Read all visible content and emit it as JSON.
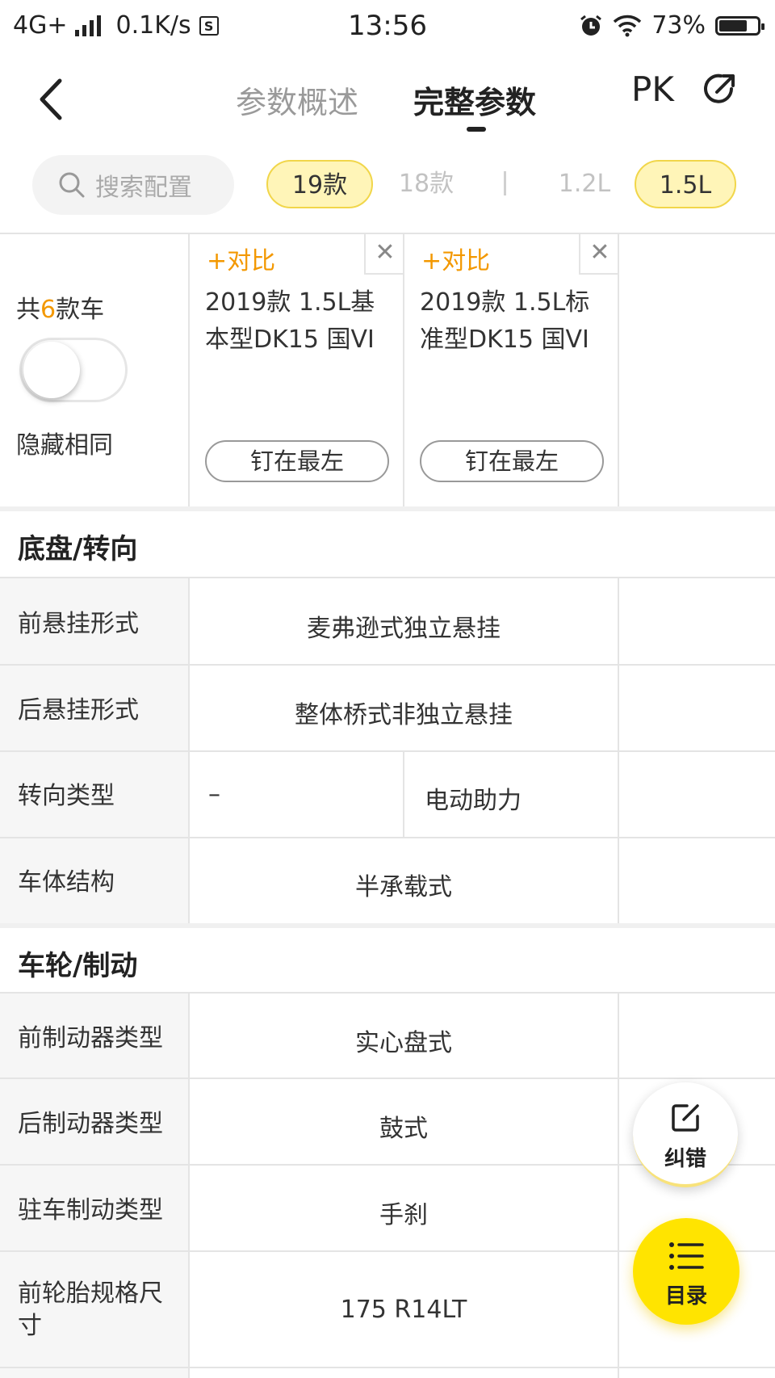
{
  "status_bar": {
    "network": "4G+",
    "speed": "0.1K/s",
    "sim_badge": "S",
    "time": "13:56",
    "battery": "73%",
    "battery_level": 0.73
  },
  "nav": {
    "tab_overview": "参数概述",
    "tab_full": "完整参数",
    "pk": "PK"
  },
  "filters": {
    "search_placeholder": "搜索配置",
    "chips": [
      "19款",
      "18款",
      "1.2L",
      "1.5L"
    ]
  },
  "header": {
    "count_prefix": "共",
    "count_num": "6",
    "count_suffix": "款车",
    "hide_same": "隐藏相同",
    "toggle_on": false,
    "cars": [
      {
        "compare": "+对比",
        "name": "2019款 1.5L基本型DK15 国VI",
        "pin": "钉在最左"
      },
      {
        "compare": "+对比",
        "name": "2019款 1.5L标准型DK15 国VI",
        "pin": "钉在最左"
      }
    ]
  },
  "sections": [
    {
      "title": "底盘/转向",
      "rows": [
        {
          "label": "前悬挂形式",
          "value": "麦弗逊式独立悬挂"
        },
        {
          "label": "后悬挂形式",
          "value": "整体桥式非独立悬挂"
        },
        {
          "label": "转向类型",
          "values": [
            "–",
            "电动助力"
          ]
        },
        {
          "label": "车体结构",
          "value": "半承载式"
        }
      ]
    },
    {
      "title": "车轮/制动",
      "rows": [
        {
          "label": "前制动器类型",
          "value": "实心盘式"
        },
        {
          "label": "后制动器类型",
          "value": "鼓式"
        },
        {
          "label": "驻车制动类型",
          "value": "手刹"
        },
        {
          "label": "前轮胎规格尺寸",
          "value": "175 R14LT"
        }
      ]
    }
  ],
  "fab": {
    "fix": "纠错",
    "toc": "目录"
  }
}
